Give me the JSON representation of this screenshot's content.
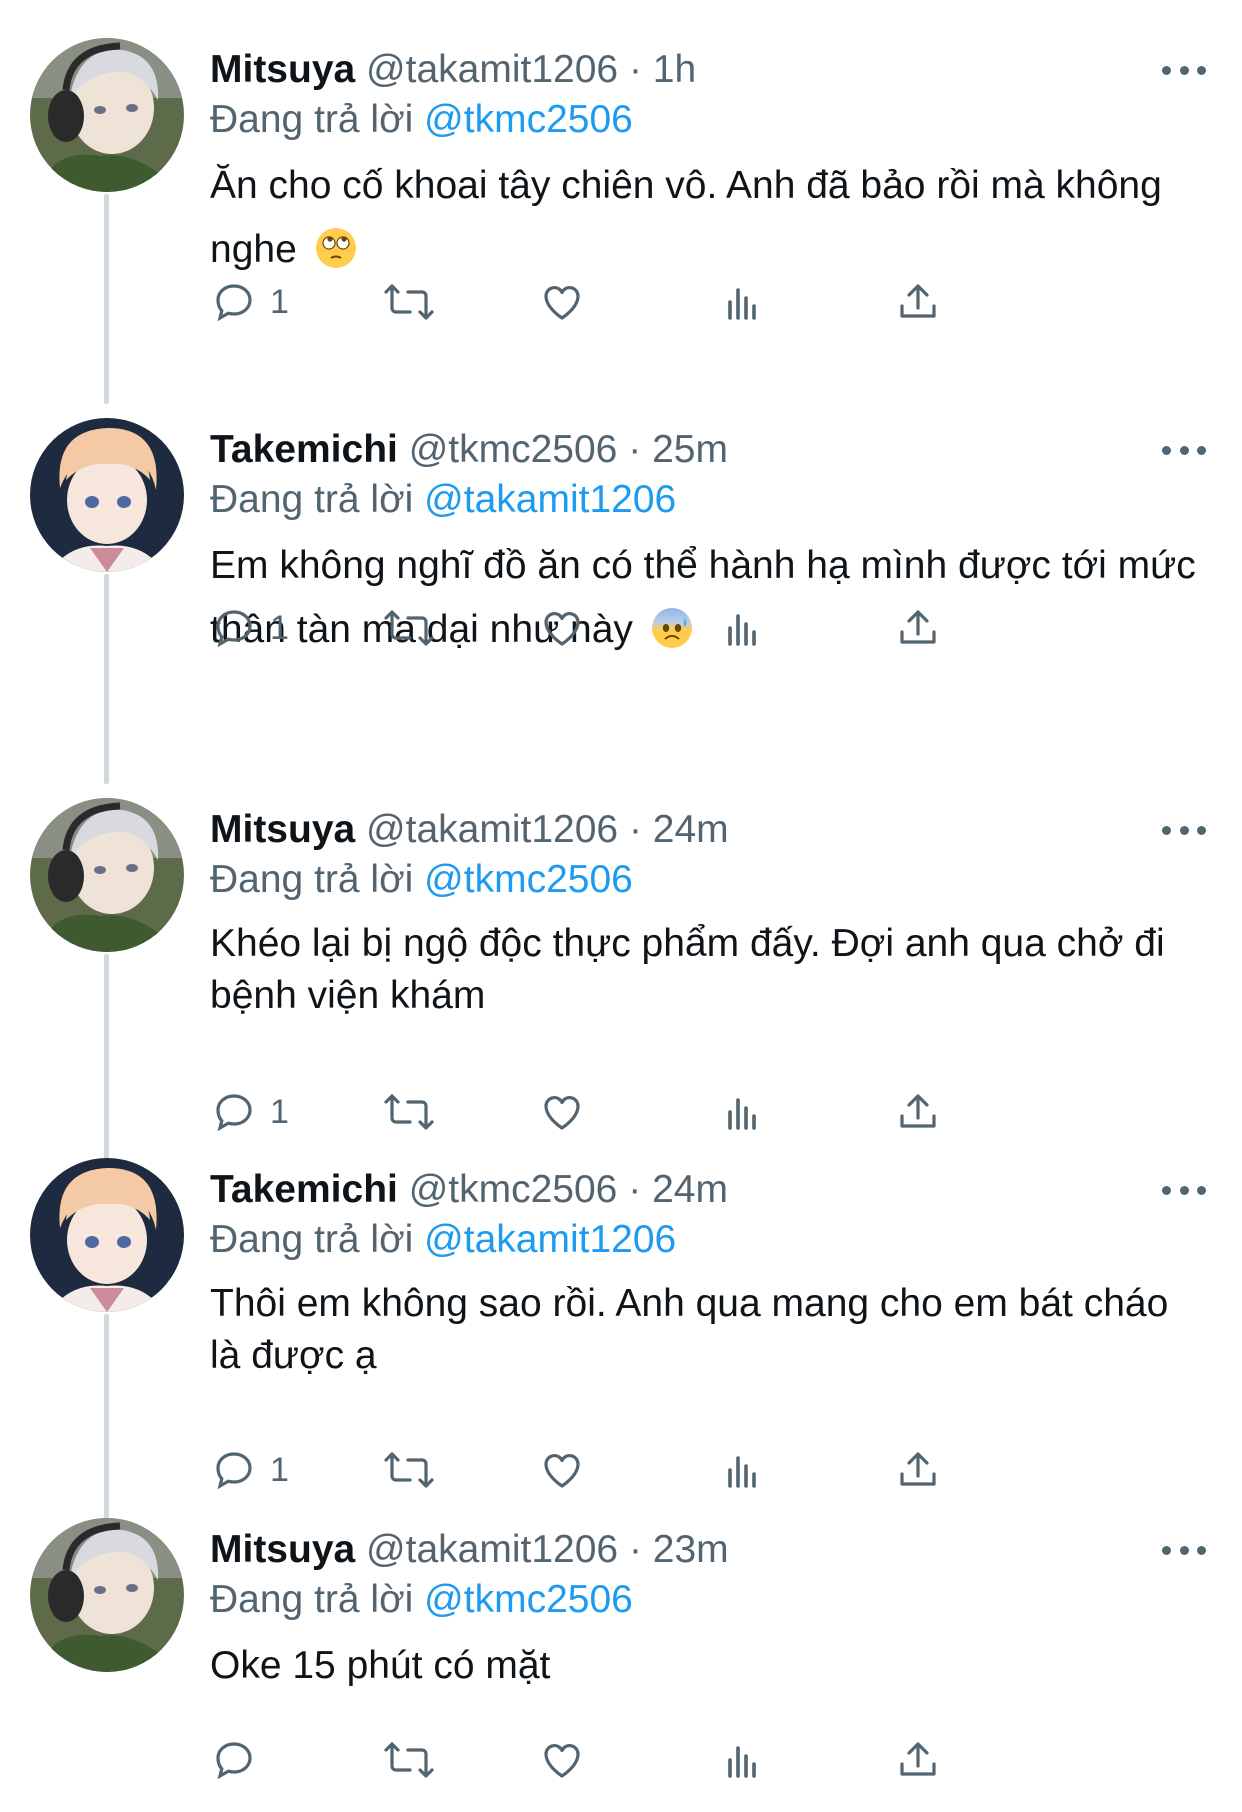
{
  "reply_prefix": "Đang trả lời",
  "tweets": [
    {
      "name": "Mitsuya",
      "handle": "@takamit1206",
      "dot": "·",
      "time": "1h",
      "reply_to": "@tkmc2506",
      "text": "Ăn cho cố khoai tây chiên vô. Anh đã bảo rồi mà không nghe",
      "emoji": "face-with-rolling-eyes",
      "reply_count": "1",
      "avatar": "mitsuya-avatar"
    },
    {
      "name": "Takemichi",
      "handle": "@tkmc2506",
      "dot": "·",
      "time": "25m",
      "reply_to": "@takamit1206",
      "text": "Em không nghĩ đồ ăn có thể hành hạ mình được tới mức thân tàn ma dại như này",
      "emoji": "anxious-face-with-sweat",
      "reply_count": "1",
      "avatar": "takemichi-avatar"
    },
    {
      "name": "Mitsuya",
      "handle": "@takamit1206",
      "dot": "·",
      "time": "24m",
      "reply_to": "@tkmc2506",
      "text": "Khéo lại bị ngộ độc thực phẩm đấy. Đợi anh qua chở đi bệnh viện khám",
      "reply_count": "1",
      "avatar": "mitsuya-avatar"
    },
    {
      "name": "Takemichi",
      "handle": "@tkmc2506",
      "dot": "·",
      "time": "24m",
      "reply_to": "@takamit1206",
      "text": "Thôi em không sao rồi. Anh qua mang cho em bát cháo là được ạ",
      "reply_count": "1",
      "avatar": "takemichi-avatar"
    },
    {
      "name": "Mitsuya",
      "handle": "@takamit1206",
      "dot": "·",
      "time": "23m",
      "reply_to": "@tkmc2506",
      "text": "Oke 15 phút có mặt",
      "reply_count": "",
      "avatar": "mitsuya-avatar"
    }
  ]
}
